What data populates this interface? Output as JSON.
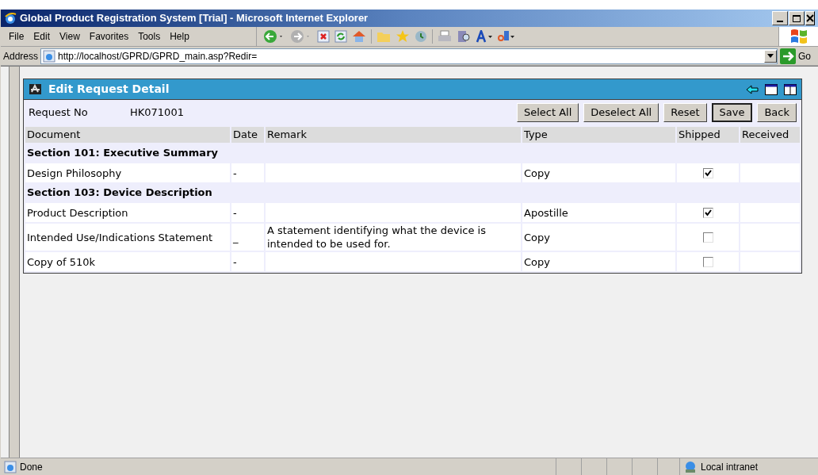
{
  "window": {
    "title": "Global Product Registration System [Trial] - Microsoft Internet Explorer"
  },
  "menu": [
    "File",
    "Edit",
    "View",
    "Favorites",
    "Tools",
    "Help"
  ],
  "address": {
    "label": "Address",
    "value": "http://localhost/GPRD/GPRD_main.asp?Redir=",
    "go": "Go"
  },
  "panel": {
    "title": "Edit Request Detail",
    "request_label": "Request No",
    "request_no": "HK071001",
    "buttons": [
      {
        "label": "Select All",
        "selected": false
      },
      {
        "label": "Deselect All",
        "selected": false
      },
      {
        "label": "Reset",
        "selected": false
      },
      {
        "label": "Save",
        "selected": true
      },
      {
        "label": "Back",
        "selected": false
      }
    ],
    "columns": [
      "Document",
      "Date",
      "Remark",
      "Type",
      "Shipped",
      "Received"
    ],
    "rows": [
      {
        "kind": "section",
        "title": "Section 101: Executive Summary"
      },
      {
        "kind": "item",
        "document": "Design Philosophy",
        "date": "-",
        "type": "Copy",
        "shipped": true
      },
      {
        "kind": "section",
        "title": "Section 103: Device Description"
      },
      {
        "kind": "item",
        "document": "Product Description",
        "date": "-",
        "type": "Apostille",
        "shipped": true
      },
      {
        "kind": "item",
        "document": "Intended Use/Indications Statement",
        "date": "_",
        "remark": "A statement identifying what the device is intended to be used for.",
        "type": "Copy",
        "shipped": false
      },
      {
        "kind": "item",
        "document": "Copy of 510k",
        "date": "-",
        "type": "Copy",
        "shipped": false
      }
    ]
  },
  "status_bar": {
    "text": "Done",
    "zone": "Local intranet"
  }
}
